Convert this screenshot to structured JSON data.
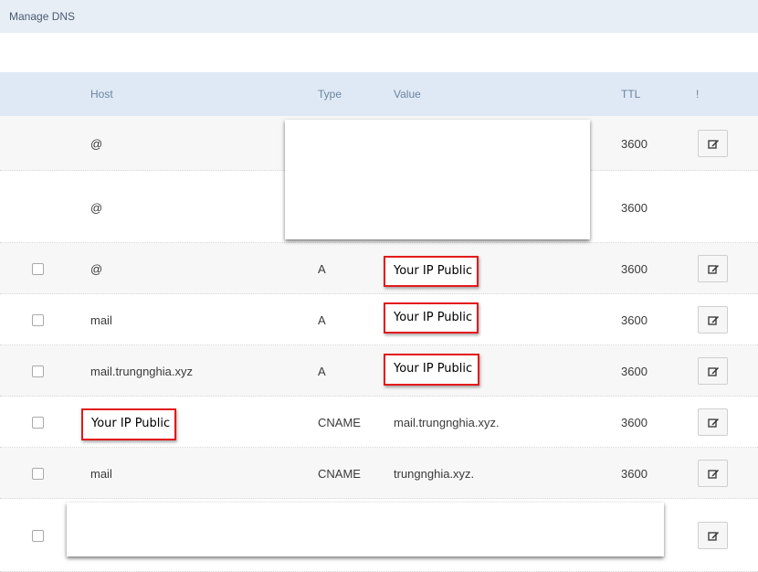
{
  "header": {
    "title": "Manage DNS"
  },
  "table": {
    "columns": {
      "host": "Host",
      "type": "Type",
      "value": "Value",
      "ttl": "TTL",
      "action": "!"
    },
    "rows": [
      {
        "host": "@",
        "type": "",
        "value": "",
        "ttl": "3600"
      },
      {
        "host": "@",
        "type": "",
        "value": "",
        "ttl": "3600"
      },
      {
        "host": "@",
        "type": "A",
        "value": "Your IP Public",
        "ttl": "3600"
      },
      {
        "host": "mail",
        "type": "A",
        "value": "Your IP Public",
        "ttl": "3600"
      },
      {
        "host": "mail.trungnghia.xyz",
        "type": "A",
        "value": "Your IP Public",
        "ttl": "3600"
      },
      {
        "host": "Your IP Public",
        "type": "CNAME",
        "value": "mail.trungnghia.xyz.",
        "ttl": "3600"
      },
      {
        "host": "mail",
        "type": "CNAME",
        "value": "trungnghia.xyz.",
        "ttl": "3600"
      },
      {
        "host": "",
        "type": "",
        "value": "",
        "ttl": ""
      }
    ]
  },
  "colors": {
    "highlight_border": "#e21b1b",
    "header_bg": "#dfe9f5",
    "topbar_bg": "#e8eef6"
  },
  "icons": {
    "edit": "pencil-square-icon"
  }
}
